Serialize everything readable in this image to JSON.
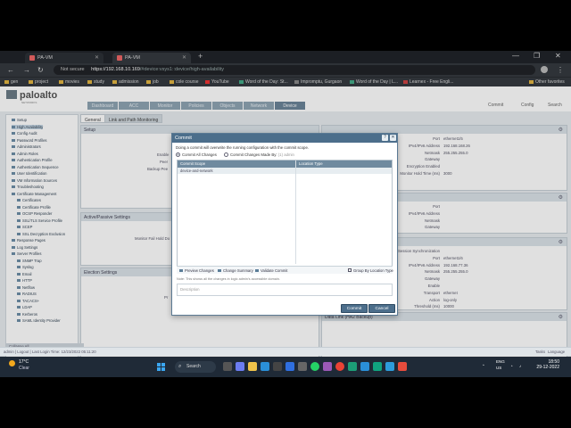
{
  "browser": {
    "tabs": [
      {
        "title": "PA-VM",
        "active": false
      },
      {
        "title": "PA-VM",
        "active": true
      }
    ],
    "security": "Not secure",
    "url_host": "https://192.168.10.169",
    "url_path": "/#device:vsys1::device/high-availability",
    "bookmarks": [
      "gen",
      "project",
      "movies",
      "study",
      "admission",
      "job",
      "cole course",
      "YouTube",
      "Word of the Day: St...",
      "Impromptu, Gurgaon",
      "Word of the Day | L...",
      "Learnex - Free Engli...",
      "Other favorites"
    ]
  },
  "app": {
    "logo": "paloalto",
    "logo_sub": "NETWORKS",
    "nav": [
      "Dashboard",
      "ACC",
      "Monitor",
      "Policies",
      "Objects",
      "Network",
      "Device"
    ],
    "active_nav": "Device",
    "header_actions": [
      "Commit",
      "Config",
      "Search"
    ],
    "sidebar": [
      "Setup",
      "High Availability",
      "Config Audit",
      "Password Profiles",
      "Administrators",
      "Admin Roles",
      "Authentication Profile",
      "Authentication Sequence",
      "User Identification",
      "VM Information Sources",
      "Troubleshooting",
      "Certificate Management",
      "Certificates",
      "Certificate Profile",
      "OCSP Responder",
      "SSL/TLS Service Profile",
      "SCEP",
      "SSL Decryption Exclusion",
      "Response Pages",
      "Log Settings",
      "Server Profiles",
      "SNMP Trap",
      "Syslog",
      "Email",
      "HTTP",
      "Netflow",
      "RADIUS",
      "TACACS+",
      "LDAP",
      "Kerberos",
      "SAML Identity Provider"
    ],
    "sub_tabs": [
      "General",
      "Link and Path Monitoring"
    ],
    "panels": {
      "setup": "Setup",
      "active_passive": "Active/Passive Settings",
      "election": "Election Settings",
      "data_link": "Data Link (HA2 Backup)"
    },
    "ha1": [
      {
        "k": "Port",
        "v": "ethernet1/5"
      },
      {
        "k": "IPv4/IPv6 Address",
        "v": "192.168.168.26"
      },
      {
        "k": "Netmask",
        "v": "255.255.255.0"
      },
      {
        "k": "Gateway",
        "v": ""
      },
      {
        "k": "Encryption Enabled",
        "v": ""
      },
      {
        "k": "Monitor Hold Time (ms)",
        "v": "3000"
      }
    ],
    "ha1b": [
      {
        "k": "Port",
        "v": ""
      },
      {
        "k": "IPv4/IPv6 Address",
        "v": ""
      },
      {
        "k": "Netmask",
        "v": ""
      },
      {
        "k": "Gateway",
        "v": ""
      }
    ],
    "ha2": [
      {
        "k": "Session Synchronization",
        "v": ""
      },
      {
        "k": "Port",
        "v": "ethernet1/6"
      },
      {
        "k": "IPv4/IPv6 Address",
        "v": "192.168.77.36"
      },
      {
        "k": "Netmask",
        "v": "255.255.255.0"
      },
      {
        "k": "Gateway",
        "v": ""
      },
      {
        "k": "Enable",
        "v": ""
      },
      {
        "k": "Transport",
        "v": "ethernet"
      },
      {
        "k": "Action",
        "v": "log-only"
      },
      {
        "k": "Threshold (ms)",
        "v": "10000"
      }
    ],
    "left_fragments": [
      "Enable",
      "Peer",
      "Backup Pee",
      "Monitor Fail Hold Do",
      "Pr",
      "Preemption",
      "Promotion Hold Time",
      "Hello Interval (ms)",
      "Heartbeat Interval (ms)",
      "Max Flaps",
      "Flap Hold Time",
      "Hold Time Ratio",
      "Monitor Fail Hold Down",
      "Preemption Hold Time",
      "Promotion Hold",
      "Hello Interval (ms)",
      "Heartbeat Interval",
      "Flap Max",
      "Max Flaps",
      "Flaps Hold Time",
      "Automatic"
    ],
    "left_values": [
      "60",
      "Automatic"
    ],
    "status_left": "admin | Logout | Last Login Time: 12/23/2022 05:11:20",
    "status_right": [
      "Tasks",
      "Language"
    ],
    "collapse": "Collapse All"
  },
  "modal": {
    "title": "Commit",
    "description": "Doing a commit will overwrite the running configuration with the commit scope.",
    "options": [
      "Commit All Changes",
      "Commit Changes Made By:"
    ],
    "options_suffix": "(1) admin",
    "selected": "Commit All Changes",
    "columns": [
      "Commit Scope",
      "Location Type"
    ],
    "rows": [
      {
        "scope": "device-and-network",
        "location": ""
      }
    ],
    "toolbar": [
      "Preview Changes",
      "Change Summary",
      "Validate Commit",
      "Group By Location Type"
    ],
    "note": "Note: This shows all the changes in logic admin's accessible domain.",
    "description_placeholder": "Description",
    "buttons": [
      "Commit",
      "Cancel"
    ]
  },
  "taskbar": {
    "temp": "17°C",
    "weather": "Clear",
    "search": "Search",
    "lang": "ENG",
    "region": "US",
    "time": "18:50",
    "date": "29-12-2022"
  },
  "colors": {
    "nav_active": "#6c8599",
    "modal_header": "#4c6e8b",
    "grid_header": "#6f8a9f"
  }
}
